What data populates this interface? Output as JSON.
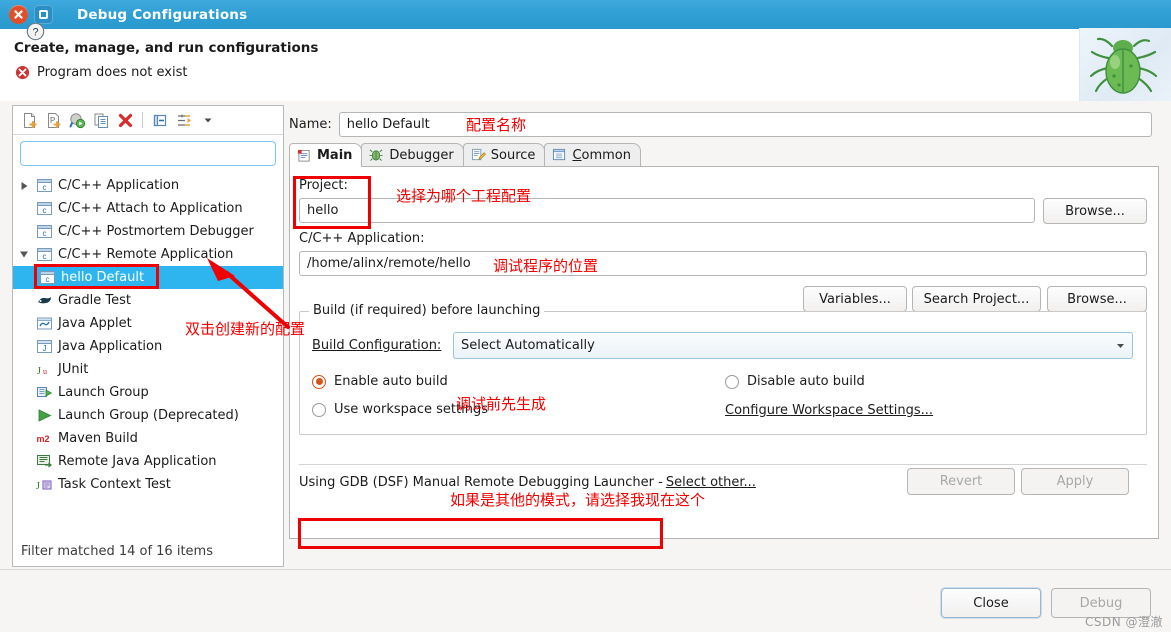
{
  "window": {
    "title": "Debug Configurations",
    "close_icon": "close-icon",
    "maximize_icon": "maximize-icon"
  },
  "banner": {
    "title": "Create, manage, and run configurations",
    "status": "Program does not exist",
    "status_icon": "error-icon",
    "decor_icon": "bug-icon"
  },
  "left_panel": {
    "toolbar": [
      {
        "name": "new-configuration-icon",
        "title": "New launch configuration"
      },
      {
        "name": "new-prototype-icon",
        "title": "New prototype"
      },
      {
        "name": "export-icon",
        "title": "Export"
      },
      {
        "name": "duplicate-icon",
        "title": "Duplicate"
      },
      {
        "name": "delete-icon",
        "title": "Delete"
      },
      {
        "name": "collapse-all-icon",
        "title": "Collapse All"
      },
      {
        "name": "filter-icon",
        "title": "Filter launch configurations"
      },
      {
        "name": "chevron-down-icon",
        "title": "View menu"
      }
    ],
    "filter": {
      "value": "",
      "placeholder": ""
    },
    "tree": [
      {
        "label": "C/C++ Application",
        "icon": "cpp-icon",
        "twisty": "collapsed",
        "level": 0,
        "selected": false
      },
      {
        "label": "C/C++ Attach to Application",
        "icon": "cpp-icon",
        "twisty": "none",
        "level": 0,
        "selected": false
      },
      {
        "label": "C/C++ Postmortem Debugger",
        "icon": "cpp-icon",
        "twisty": "none",
        "level": 0,
        "selected": false
      },
      {
        "label": "C/C++ Remote Application",
        "icon": "cpp-icon",
        "twisty": "expanded",
        "level": 0,
        "selected": false
      },
      {
        "label": "hello Default",
        "icon": "cpp-icon",
        "twisty": "none",
        "level": 1,
        "selected": true
      },
      {
        "label": "Gradle Test",
        "icon": "gradle-icon",
        "twisty": "none",
        "level": 0,
        "selected": false
      },
      {
        "label": "Java Applet",
        "icon": "java-applet-icon",
        "twisty": "none",
        "level": 0,
        "selected": false
      },
      {
        "label": "Java Application",
        "icon": "java-app-icon",
        "twisty": "none",
        "level": 0,
        "selected": false
      },
      {
        "label": "JUnit",
        "icon": "junit-icon",
        "twisty": "none",
        "level": 0,
        "selected": false
      },
      {
        "label": "Launch Group",
        "icon": "launch-group-icon",
        "twisty": "none",
        "level": 0,
        "selected": false
      },
      {
        "label": "Launch Group (Deprecated)",
        "icon": "play-icon",
        "twisty": "none",
        "level": 0,
        "selected": false
      },
      {
        "label": "Maven Build",
        "icon": "maven-icon",
        "twisty": "none",
        "level": 0,
        "selected": false
      },
      {
        "label": "Remote Java Application",
        "icon": "remote-java-icon",
        "twisty": "none",
        "level": 0,
        "selected": false
      },
      {
        "label": "Task Context Test",
        "icon": "task-context-icon",
        "twisty": "none",
        "level": 0,
        "selected": false
      }
    ],
    "status": "Filter matched 14 of 16 items"
  },
  "right_panel": {
    "name_label": "Name:",
    "name_value": "hello Default",
    "tabs": [
      {
        "label": "Main",
        "icon": "main-tab-icon",
        "active": true
      },
      {
        "label": "Debugger",
        "icon": "debugger-tab-icon",
        "active": false
      },
      {
        "label": "Source",
        "icon": "source-tab-icon",
        "active": false
      },
      {
        "label": "Common",
        "icon": "common-tab-icon",
        "active": false,
        "mnemonic": "C"
      }
    ],
    "project_label": "Project:",
    "project_value": "hello",
    "project_browse": "Browse...",
    "app_label": "C/C++ Application:",
    "app_value": "/home/alinx/remote/hello",
    "app_buttons": [
      "Variables...",
      "Search Project...",
      "Browse..."
    ],
    "build_group_legend": "Build (if required) before launching",
    "build_config_label": "Build Configuration:",
    "build_config_value": "Select Automatically",
    "radio_enable_auto": "Enable auto build",
    "radio_disable_auto": "Disable auto build",
    "radio_use_workspace": "Use workspace settings",
    "configure_workspace_link": "Configure Workspace Settings...",
    "launcher_text": "Using GDB (DSF) Manual Remote Debugging Launcher -",
    "launcher_link": "Select other...",
    "revert_button": "Revert",
    "apply_button": "Apply"
  },
  "footer": {
    "help_icon": "help-icon",
    "close_button": "Close",
    "debug_button": "Debug",
    "watermark": "CSDN @澄澈"
  },
  "annotations": [
    {
      "name": "annotation-config-name",
      "text": "配置名称"
    },
    {
      "name": "annotation-choose-project",
      "text": "选择为哪个工程配置"
    },
    {
      "name": "annotation-debug-program-path",
      "text": "调试程序的位置"
    },
    {
      "name": "annotation-create-new-config",
      "text": "双击创建新的配置"
    },
    {
      "name": "annotation-build-before-debug",
      "text": "调试前先生成"
    },
    {
      "name": "annotation-select-this-launcher",
      "text": "如果是其他的模式，请选择我现在这个"
    }
  ],
  "colors": {
    "titlebar": "#2f9fd4",
    "selection": "#2eb5f0",
    "annotation": "#ee0000",
    "radio_on": "#d4541d",
    "close_button": "#e04f2a"
  }
}
